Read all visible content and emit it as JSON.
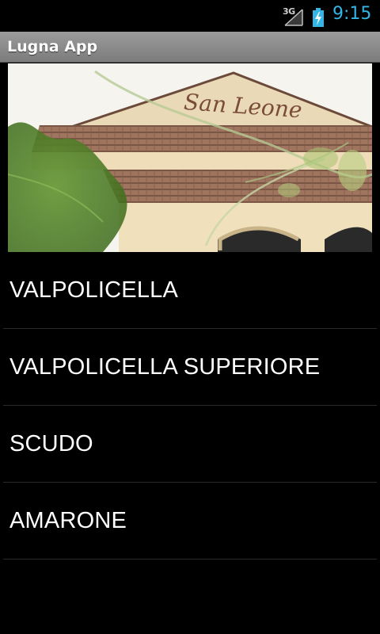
{
  "status_bar": {
    "network": "3G",
    "time": "9:15"
  },
  "app": {
    "title": "Lugna App"
  },
  "hero": {
    "sign_text": "San Leone"
  },
  "wines": [
    {
      "label": "VALPOLICELLA"
    },
    {
      "label": "VALPOLICELLA SUPERIORE"
    },
    {
      "label": "SCUDO"
    },
    {
      "label": "AMARONE"
    }
  ]
}
